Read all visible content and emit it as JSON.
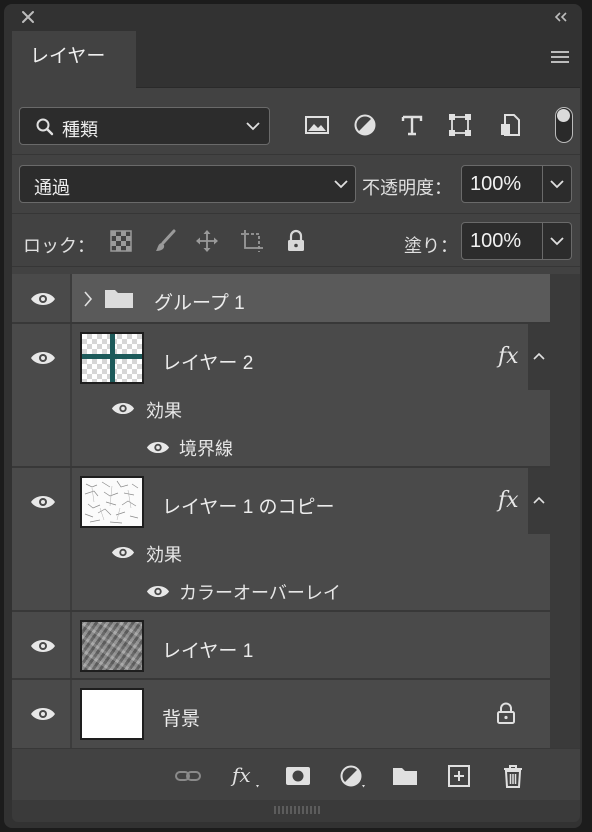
{
  "window": {
    "tab_title": "レイヤー"
  },
  "filter": {
    "kind_label": "種類",
    "filter_icons": [
      "image-filter-icon",
      "adjustment-filter-icon",
      "type-filter-icon",
      "shape-filter-icon",
      "smart-object-filter-icon"
    ],
    "toggle_state": "on"
  },
  "blend": {
    "mode": "通過",
    "opacity_label": "不透明度：",
    "opacity_value": "100%"
  },
  "lock": {
    "label": "ロック：",
    "fill_label": "塗り：",
    "fill_value": "100%"
  },
  "layers": [
    {
      "name": "グループ 1",
      "type": "group",
      "visible": true
    },
    {
      "name": "レイヤー 2",
      "type": "layer",
      "visible": true,
      "fx": "fx",
      "effects_label": "効果",
      "effects": [
        "境界線"
      ]
    },
    {
      "name": "レイヤー 1 のコピー",
      "type": "layer",
      "visible": true,
      "fx": "fx",
      "effects_label": "効果",
      "effects": [
        "カラーオーバーレイ"
      ]
    },
    {
      "name": "レイヤー 1",
      "type": "layer",
      "visible": true
    },
    {
      "name": "背景",
      "type": "background",
      "visible": true,
      "locked": true
    }
  ],
  "colors": {
    "panel_bg": "#424242",
    "row_bg": "#4a4a4a",
    "group_row_bg": "#5a5a5a",
    "accent_teal": "#1d5a5a"
  }
}
